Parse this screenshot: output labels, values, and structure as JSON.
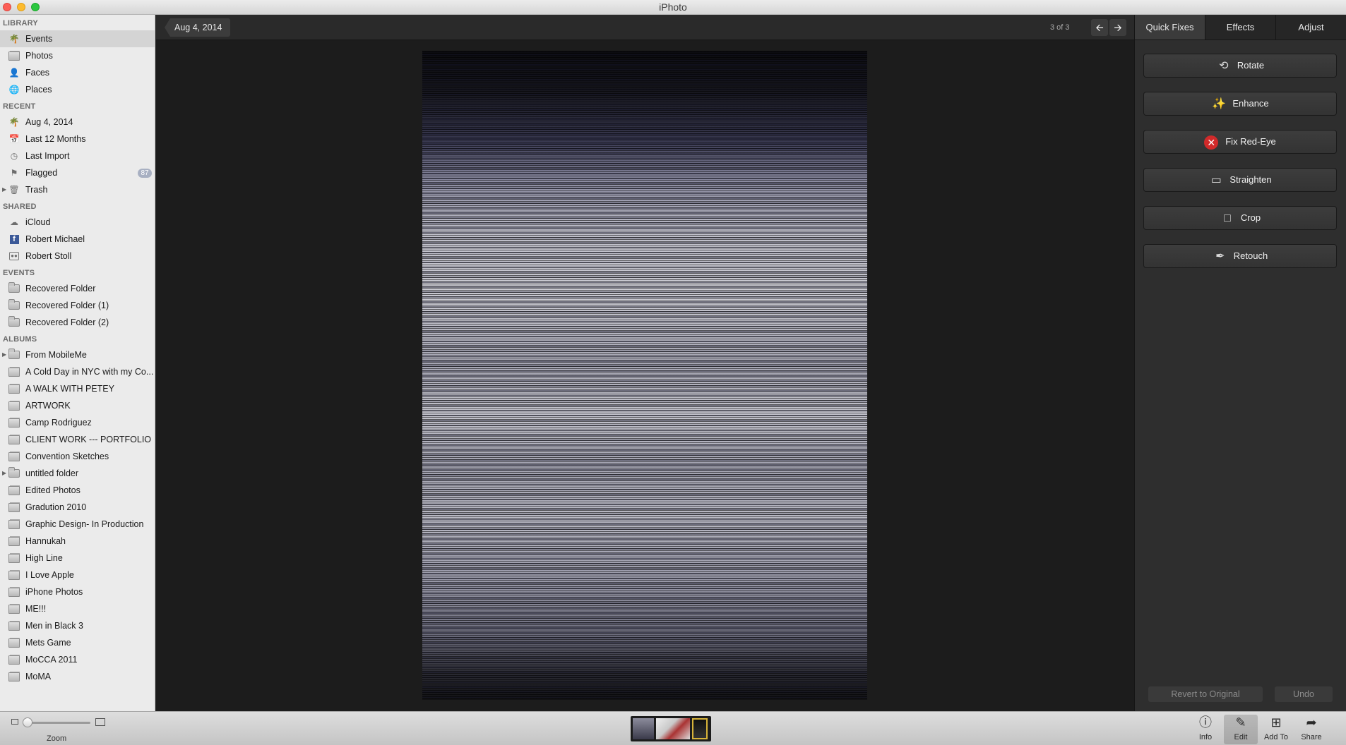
{
  "window": {
    "title": "iPhoto"
  },
  "sidebar": {
    "library": {
      "heading": "LIBRARY",
      "items": [
        {
          "label": "Events",
          "icon": "palm-tree-icon",
          "selected": true
        },
        {
          "label": "Photos",
          "icon": "photos-icon"
        },
        {
          "label": "Faces",
          "icon": "person-icon"
        },
        {
          "label": "Places",
          "icon": "globe-icon"
        }
      ]
    },
    "recent": {
      "heading": "RECENT",
      "items": [
        {
          "label": "Aug 4, 2014",
          "icon": "palm-tree-icon"
        },
        {
          "label": "Last 12 Months",
          "icon": "calendar-icon"
        },
        {
          "label": "Last Import",
          "icon": "clock-icon"
        },
        {
          "label": "Flagged",
          "icon": "flag-icon",
          "badge": "87"
        },
        {
          "label": "Trash",
          "icon": "trash-icon"
        }
      ]
    },
    "shared": {
      "heading": "SHARED",
      "items": [
        {
          "label": "iCloud",
          "icon": "cloud-icon"
        },
        {
          "label": "Robert Michael",
          "icon": "facebook-icon"
        },
        {
          "label": "Robert Stoll",
          "icon": "flickr-icon"
        }
      ]
    },
    "events": {
      "heading": "EVENTS",
      "items": [
        {
          "label": "Recovered Folder"
        },
        {
          "label": "Recovered Folder (1)"
        },
        {
          "label": "Recovered Folder (2)"
        }
      ]
    },
    "albums": {
      "heading": "ALBUMS",
      "items": [
        {
          "label": "From MobileMe",
          "folder": true
        },
        {
          "label": "A Cold Day in NYC with my Co..."
        },
        {
          "label": "A WALK WITH PETEY"
        },
        {
          "label": "ARTWORK"
        },
        {
          "label": "Camp Rodriguez"
        },
        {
          "label": "CLIENT WORK --- PORTFOLIO"
        },
        {
          "label": "Convention Sketches"
        },
        {
          "label": "untitled folder",
          "folder": true
        },
        {
          "label": "Edited Photos"
        },
        {
          "label": "Gradution 2010"
        },
        {
          "label": "Graphic Design- In Production"
        },
        {
          "label": "Hannukah"
        },
        {
          "label": "High Line"
        },
        {
          "label": "I Love Apple"
        },
        {
          "label": "iPhone Photos"
        },
        {
          "label": "ME!!!"
        },
        {
          "label": "Men in Black 3"
        },
        {
          "label": "Mets Game"
        },
        {
          "label": "MoCCA 2011"
        },
        {
          "label": "MoMA"
        }
      ]
    }
  },
  "toolbar": {
    "breadcrumb": "Aug 4, 2014",
    "counter": "3 of 3"
  },
  "panel": {
    "tabs": [
      "Quick Fixes",
      "Effects",
      "Adjust"
    ],
    "active_tab": "Quick Fixes",
    "quick_fixes": [
      {
        "label": "Rotate",
        "icon": "rotate-icon"
      },
      {
        "label": "Enhance",
        "icon": "magic-wand-icon"
      },
      {
        "label": "Fix Red-Eye",
        "icon": "red-eye-icon"
      },
      {
        "label": "Straighten",
        "icon": "straighten-icon"
      },
      {
        "label": "Crop",
        "icon": "crop-icon"
      },
      {
        "label": "Retouch",
        "icon": "brush-icon"
      }
    ],
    "revert_label": "Revert to Original",
    "undo_label": "Undo"
  },
  "bottom": {
    "zoom_label": "Zoom",
    "tools": [
      {
        "label": "Info",
        "icon": "info-icon"
      },
      {
        "label": "Edit",
        "icon": "pencil-icon",
        "active": true
      },
      {
        "label": "Add To",
        "icon": "plus-icon"
      },
      {
        "label": "Share",
        "icon": "share-icon"
      }
    ]
  }
}
